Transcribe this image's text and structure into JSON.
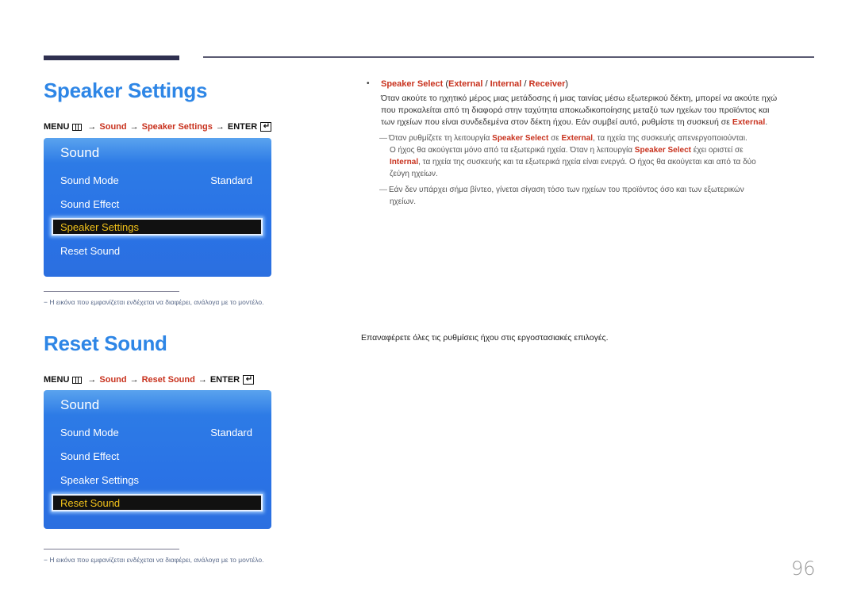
{
  "page_number": "96",
  "sections": [
    {
      "title": "Speaker Settings",
      "menu_path": {
        "menu": "MENU",
        "arrow": "→",
        "step1": "Sound",
        "step2": "Speaker Settings",
        "enter": "ENTER",
        "enter_glyph": "↵"
      },
      "tv_menu": {
        "title": "Sound",
        "items": [
          {
            "label": "Sound Mode",
            "value": "Standard"
          },
          {
            "label": "Sound Effect",
            "value": ""
          },
          {
            "label": "Speaker Settings",
            "value": "",
            "selected": true
          },
          {
            "label": "Reset Sound",
            "value": ""
          }
        ]
      },
      "footnote": "− Η εικόνα που εμφανίζεται ενδέχεται να διαφέρει, ανάλογα με το μοντέλο."
    },
    {
      "title": "Reset Sound",
      "menu_path": {
        "menu": "MENU",
        "arrow": "→",
        "step1": "Sound",
        "step2": "Reset Sound",
        "enter": "ENTER",
        "enter_glyph": "↵"
      },
      "tv_menu": {
        "title": "Sound",
        "items": [
          {
            "label": "Sound Mode",
            "value": "Standard"
          },
          {
            "label": "Sound Effect",
            "value": ""
          },
          {
            "label": "Speaker Settings",
            "value": ""
          },
          {
            "label": "Reset Sound",
            "value": "",
            "selected": true
          }
        ]
      },
      "footnote": "− Η εικόνα που εμφανίζεται ενδέχεται να διαφέρει, ανάλογα με το μοντέλο.",
      "description": "Επαναφέρετε όλες τις ρυθμίσεις ήχου στις εργοστασιακές επιλογές."
    }
  ],
  "speaker_select": {
    "bullet": "•",
    "name": "Speaker Select",
    "options": [
      "External",
      "Internal",
      "Receiver"
    ],
    "para_line1": "Όταν ακούτε το ηχητικό μέρος μιας μετάδοσης ή μιας ταινίας μέσω εξωτερικού δέκτη, μπορεί να ακούτε ηχώ",
    "para_line2": "που προκαλείται από τη διαφορά στην ταχύτητα αποκωδικοποίησης μεταξύ των ηχείων του προϊόντος και",
    "para_line3_pre": "των ηχείων που είναι συνδεδεμένα στον δέκτη ήχου. Εάν συμβεί αυτό, ρυθμίστε τη συσκευή σε ",
    "para_line3_hl": "External",
    "para_line3_post": ".",
    "notes": [
      {
        "dash": "―",
        "l1_a": "Όταν ρυθμίζετε τη λειτουργία ",
        "l1_hl1": "Speaker Select",
        "l1_b": " σε ",
        "l1_hl2": "External",
        "l1_c": ", τα ηχεία της συσκευής απενεργοποιούνται.",
        "l2_a": "Ο ήχος θα ακούγεται μόνο από τα εξωτερικά ηχεία. Όταν η λειτουργία ",
        "l2_hl": "Speaker Select",
        "l2_b": " έχει οριστεί σε",
        "l3_hl": "Internal",
        "l3_a": ", τα ηχεία της συσκευής και τα εξωτερικά ηχεία είναι ενεργά. Ο ήχος θα ακούγεται και από τα δύο",
        "l4": "ζεύγη ηχείων."
      },
      {
        "dash": "―",
        "l1": "Εάν δεν υπάρχει σήμα βίντεο, γίνεται σίγαση τόσο των ηχείων του προϊόντος όσο και των εξωτερικών",
        "l2": "ηχείων."
      }
    ]
  },
  "colors": {
    "title_blue": "#2e86e6",
    "highlight_red": "#c8321e",
    "menu_blue": "#2a73e6",
    "selected_text": "#f2c21a"
  }
}
